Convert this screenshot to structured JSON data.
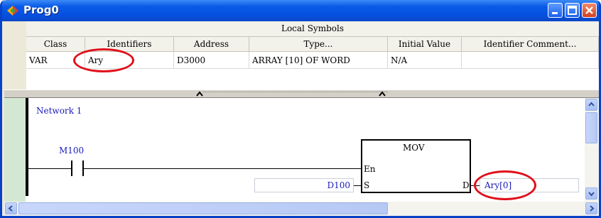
{
  "window": {
    "title": "Prog0"
  },
  "symbols": {
    "section_title": "Local Symbols",
    "columns": [
      "Class",
      "Identifiers",
      "Address",
      "Type...",
      "Initial Value",
      "Identifier Comment..."
    ],
    "rows": [
      {
        "class": "VAR",
        "identifier": "Ary",
        "address": "D3000",
        "type": "ARRAY [10] OF WORD",
        "initial_value": "N/A",
        "comment": ""
      }
    ]
  },
  "ladder": {
    "network_label": "Network 1",
    "contact_label": "M100",
    "block": {
      "name": "MOV",
      "pin_en": "En",
      "pin_s": "S",
      "pin_d": "D"
    },
    "source_operand": "D100",
    "dest_operand": "Ary[0]"
  },
  "icons": [
    "program-icon",
    "minimize-icon",
    "maximize-icon",
    "close-icon",
    "splitter-up-arrow-icon",
    "scroll-up-icon",
    "scroll-down-icon",
    "scroll-left-icon",
    "scroll-right-icon"
  ],
  "colors": {
    "title_bar": "#0a5be8",
    "highlight_circle": "#e0101a",
    "operand_text": "#1a1ab8"
  }
}
